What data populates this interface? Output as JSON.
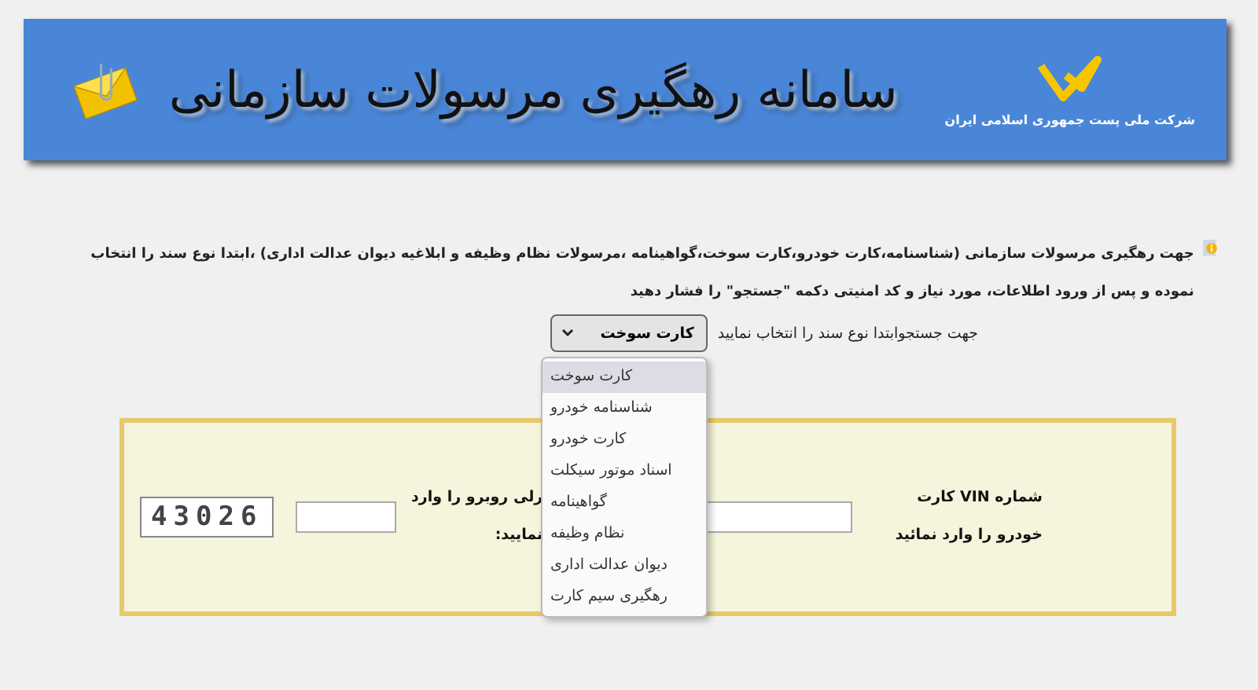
{
  "banner": {
    "title": "سامانه رهگیری مرسولات سازمانی",
    "logo_caption": "شرکت ملی پست جمهوری اسلامی ایران"
  },
  "info": {
    "text": "جهت رهگیری مرسولات سازمانی (شناسنامه،کارت خودرو،کارت سوخت،گواهینامه ،مرسولات نظام وظیفه  و ابلاغیه دیوان عدالت اداری) ،ابتدا  نوع سند را انتخاب نموده و پس از ورود اطلاعات، مورد نیاز و کد امنیتی دکمه \"جستجو\" را فشار دهید"
  },
  "doc_type": {
    "label": "جهت جستجوابتدا نوع سند را انتخاب نمایید",
    "value": "کارت سوخت",
    "expanded": true,
    "options": [
      {
        "label": "کارت سوخت",
        "selected": true
      },
      {
        "label": "شناسنامه خودرو",
        "selected": false
      },
      {
        "label": "کارت خودرو",
        "selected": false
      },
      {
        "label": "اسناد موتور سیکلت",
        "selected": false
      },
      {
        "label": "گواهینامه",
        "selected": false
      },
      {
        "label": "نظام وظیفه",
        "selected": false
      },
      {
        "label": "دیوان عدالت اداری",
        "selected": false
      },
      {
        "label": "رهگیری سیم کارت",
        "selected": false
      }
    ]
  },
  "form": {
    "vin_label": "شماره VIN کارت خودرو را وارد نمائید",
    "captcha_label": "رلی روبرو را وارد نمایید:",
    "captcha": "43026"
  }
}
